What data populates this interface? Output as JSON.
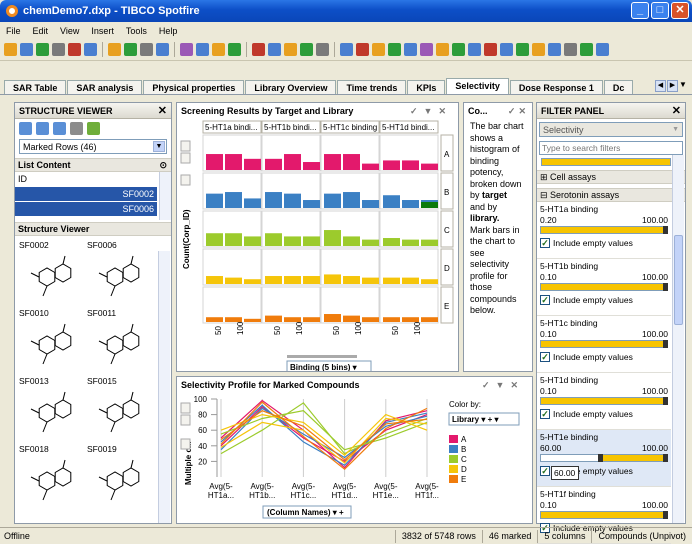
{
  "window": {
    "title": "chemDemo7.dxp - TIBCO Spotfire"
  },
  "menu": [
    "File",
    "Edit",
    "View",
    "Insert",
    "Tools",
    "Help"
  ],
  "tabs": [
    "SAR Table",
    "SAR analysis",
    "Physical properties",
    "Library Overview",
    "Time trends",
    "KPIs",
    "Selectivity",
    "Dose Response 1",
    "Dc"
  ],
  "active_tab": "Selectivity",
  "structure_viewer": {
    "title": "STRUCTURE VIEWER",
    "dropdown": "Marked Rows (46)",
    "list_content_label": "List Content",
    "id_header": "ID",
    "list_items": [
      "SF0002",
      "SF0006"
    ],
    "viewer_label": "Structure Viewer",
    "compounds": [
      "SF0002",
      "SF0006",
      "SF0010",
      "SF0011",
      "SF0013",
      "SF0015",
      "SF0018",
      "SF0019"
    ]
  },
  "screening": {
    "title": "Screening Results by Target and Library",
    "columns": [
      "5-HT1a bindi...",
      "5-HT1b bindi...",
      "5-HT1c binding",
      "5-HT1d bindi..."
    ],
    "row_labels": [
      "A",
      "B",
      "C",
      "D",
      "E"
    ],
    "y_label": "Count(Corp_ID)",
    "x_ticks": [
      "50",
      "100"
    ],
    "binding_select": "Binding (5 bins)"
  },
  "comment": {
    "title": "Co...",
    "lines": [
      "The bar chart",
      "shows a",
      "histogram of",
      "binding",
      "potency,",
      "broken down",
      "by",
      "and by",
      "Mark bars in",
      "the chart to",
      "see",
      "selectivity",
      "profile for",
      "those",
      "compounds",
      "below."
    ],
    "bold1": "target",
    "bold2": "library."
  },
  "selectivity": {
    "title": "Selectivity Profile for Marked Compounds",
    "y_ticks": [
      "100",
      "80",
      "60",
      "40",
      "20"
    ],
    "y_label": "Multiple c...",
    "x_labels": [
      [
        "Avg(5-",
        "HT1a..."
      ],
      [
        "Avg(5-",
        "HT1b..."
      ],
      [
        "Avg(5-",
        "HT1c..."
      ],
      [
        "Avg(5-",
        "HT1d..."
      ],
      [
        "Avg(5-",
        "HT1e..."
      ],
      [
        "Avg(5-",
        "HT1f..."
      ]
    ],
    "column_names": "(Column Names)",
    "color_by": "Color by:",
    "library_select": "Library",
    "legend": [
      {
        "label": "A",
        "color": "#e3196c"
      },
      {
        "label": "B",
        "color": "#3b80c4"
      },
      {
        "label": "C",
        "color": "#9ccb2c"
      },
      {
        "label": "D",
        "color": "#f5c50a"
      },
      {
        "label": "E",
        "color": "#f07c0c"
      }
    ]
  },
  "filter_panel": {
    "title": "FILTER PANEL",
    "dropdown": "Selectivity",
    "search_placeholder": "Type to search filters",
    "cell_assays": "Cell assays",
    "serotonin_assays": "Serotonin assays",
    "include_empty": "Include empty values",
    "filters": [
      {
        "name": "5-HT1a binding",
        "min": "0.20",
        "max": "100.00",
        "lo": 0.0,
        "hi": 1.0
      },
      {
        "name": "5-HT1b binding",
        "min": "0.10",
        "max": "100.00",
        "lo": 0.0,
        "hi": 1.0
      },
      {
        "name": "5-HT1c binding",
        "min": "0.10",
        "max": "100.00",
        "lo": 0.0,
        "hi": 1.0
      },
      {
        "name": "5-HT1d binding",
        "min": "0.10",
        "max": "100.00",
        "lo": 0.0,
        "hi": 1.0
      },
      {
        "name": "5-HT1e binding",
        "min": "60.00",
        "max": "100.00",
        "lo": 0.45,
        "hi": 1.0
      },
      {
        "name": "5-HT1f binding",
        "min": "0.10",
        "max": "100.00",
        "lo": 0.0,
        "hi": 1.0
      }
    ],
    "tooltip_value": "60.00"
  },
  "status": {
    "left": "Offline",
    "rows": "3832 of 5748 rows",
    "marked": "46 marked",
    "columns": "5 columns",
    "table": "Compounds (Unpivot)"
  },
  "chart_data": [
    {
      "type": "bar",
      "title": "Screening Results by Target and Library",
      "ylabel": "Count(Corp_ID)",
      "xlabel": "Binding (5 bins)",
      "panels": [
        "5-HT1a bindi...",
        "5-HT1b bindi...",
        "5-HT1c binding",
        "5-HT1d bindi..."
      ],
      "rows": [
        "A",
        "B",
        "C",
        "D",
        "E"
      ],
      "series": [
        {
          "name": "A",
          "color": "#e3196c",
          "values": [
            [
              1,
              1,
              0.7
            ],
            [
              0.7,
              1,
              0.5
            ],
            [
              1,
              1,
              0.4
            ],
            [
              0.6,
              0.6,
              0.4
            ]
          ]
        },
        {
          "name": "B",
          "color": "#3b80c4",
          "values": [
            [
              0.9,
              1,
              0.6
            ],
            [
              1,
              0.9,
              0.5
            ],
            [
              0.9,
              1,
              0.5
            ],
            [
              0.8,
              0.5,
              0.5
            ]
          ]
        },
        {
          "name": "C",
          "color": "#9ccb2c",
          "values": [
            [
              0.8,
              0.8,
              0.6
            ],
            [
              0.8,
              0.6,
              0.6
            ],
            [
              1,
              0.6,
              0.4
            ],
            [
              0.5,
              0.4,
              0.4
            ]
          ]
        },
        {
          "name": "D",
          "color": "#f5c50a",
          "values": [
            [
              0.5,
              0.4,
              0.3
            ],
            [
              0.5,
              0.5,
              0.5
            ],
            [
              0.6,
              0.5,
              0.4
            ],
            [
              0.4,
              0.4,
              0.3
            ]
          ]
        },
        {
          "name": "E",
          "color": "#f07c0c",
          "values": [
            [
              0.3,
              0.3,
              0.2
            ],
            [
              0.4,
              0.3,
              0.3
            ],
            [
              0.5,
              0.4,
              0.3
            ],
            [
              0.3,
              0.3,
              0.3
            ]
          ]
        }
      ]
    },
    {
      "type": "line",
      "title": "Selectivity Profile for Marked Compounds",
      "categories": [
        "Avg(5-HT1a...",
        "Avg(5-HT1b...",
        "Avg(5-HT1c...",
        "Avg(5-HT1d...",
        "Avg(5-HT1e...",
        "Avg(5-HT1f..."
      ],
      "ylim": [
        0,
        100
      ],
      "series": [
        {
          "name": "A",
          "color": "#e3196c",
          "values": [
            50,
            98,
            60,
            12,
            72,
            85
          ]
        },
        {
          "name": "A",
          "color": "#e3196c",
          "values": [
            40,
            90,
            50,
            20,
            60,
            80
          ]
        },
        {
          "name": "B",
          "color": "#3b80c4",
          "values": [
            35,
            88,
            55,
            25,
            65,
            78
          ]
        },
        {
          "name": "B",
          "color": "#3b80c4",
          "values": [
            45,
            92,
            45,
            15,
            70,
            82
          ]
        },
        {
          "name": "C",
          "color": "#9ccb2c",
          "values": [
            30,
            60,
            95,
            30,
            55,
            75
          ]
        },
        {
          "name": "C",
          "color": "#9ccb2c",
          "values": [
            55,
            75,
            85,
            35,
            50,
            70
          ]
        },
        {
          "name": "D",
          "color": "#f5c50a",
          "values": [
            60,
            80,
            70,
            28,
            80,
            60
          ]
        },
        {
          "name": "D",
          "color": "#f5c50a",
          "values": [
            38,
            70,
            60,
            18,
            75,
            68
          ]
        },
        {
          "name": "E",
          "color": "#f07c0c",
          "values": [
            48,
            85,
            65,
            22,
            68,
            74
          ]
        },
        {
          "name": "E",
          "color": "#f07c0c",
          "values": [
            42,
            96,
            52,
            10,
            62,
            88
          ]
        }
      ]
    }
  ]
}
